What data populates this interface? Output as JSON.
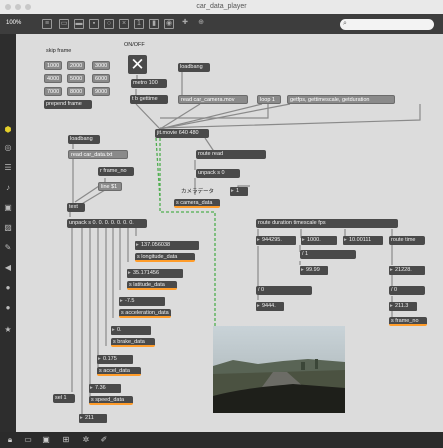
{
  "window": {
    "title": "car_data_player"
  },
  "toolbar": {
    "zoom": "100%",
    "search_placeholder": ""
  },
  "patch": {
    "skip_frame_label": "skip frame",
    "onoff_label": "ON/OFF",
    "camera_label": "カメラデータ",
    "skip_values": [
      "1000",
      "2000",
      "3000",
      "4000",
      "5000",
      "6000",
      "7000",
      "8000",
      "9000"
    ],
    "prepend_frame": "prepend frame",
    "metro": "metro 100",
    "t_b_gettime": "t b gettime",
    "loadbang_top": "loadbang",
    "read_camera": "read car_camera.mov",
    "loop": "loop 1",
    "getfps": "getfps, gettimescale, getduration",
    "jit_movie": "jit.movie 640 480",
    "loadbang_left": "loadbang",
    "read_data": "read car_data.txt",
    "r_frame_no": "r frame_no",
    "line_51": "line $1",
    "text_obj": "text",
    "unpack_floats": "unpack s 0. 0. 0. 0. 0. 0. 0.",
    "route_read": "route read",
    "unpack_s0": "unpack s 0",
    "num_1": "1",
    "s_camera_data": "s camera_data",
    "route_duration": "route duration timescale fps",
    "route_time": "route time",
    "time_val": "944295.",
    "timescale_val": "1000.",
    "fps_val": "10.00111",
    "slash_1": "/ 1",
    "val_99": "99.99",
    "slash_0": "/ 0",
    "val_9444": "9444.",
    "val_21228": "21228.",
    "slash_0_b": "/ 0",
    "val_2113": "211.3",
    "s_frame_no": "s frame_no",
    "sel_1": "sel 1",
    "data_rows": [
      {
        "value": "137.056038",
        "send": "s longitude_data"
      },
      {
        "value": "35.171456",
        "send": "s latitude_data"
      },
      {
        "value": "-7.5",
        "send": "s acceleration_data"
      },
      {
        "value": "0.",
        "send": "s brake_data"
      },
      {
        "value": "0.175",
        "send": "s accel_data"
      },
      {
        "value": "7.36",
        "send": "s speed_data"
      },
      {
        "value": "211",
        "send": ""
      }
    ]
  }
}
